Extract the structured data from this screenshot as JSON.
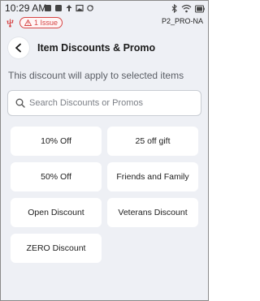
{
  "status_bar": {
    "time": "10:29 AM",
    "issue_badge": "1 Issue",
    "device_name": "P2_PRO-NA",
    "icons": [
      "notification-icon",
      "notification-icon",
      "upload-icon",
      "image-icon",
      "sync-icon",
      "bluetooth-icon",
      "wifi-icon",
      "battery-icon",
      "usb-icon",
      "warning-icon"
    ]
  },
  "header": {
    "title": "Item Discounts & Promo"
  },
  "subtitle": "This discount will apply to selected items",
  "search": {
    "placeholder": "Search Discounts or Promos",
    "value": ""
  },
  "discounts": [
    {
      "label": "10% Off"
    },
    {
      "label": "25 off gift"
    },
    {
      "label": "50% Off"
    },
    {
      "label": "Friends and Family"
    },
    {
      "label": "Open Discount"
    },
    {
      "label": "Veterans Discount"
    },
    {
      "label": "ZERO Discount"
    }
  ],
  "colors": {
    "background": "#eef0f5",
    "tile": "#ffffff",
    "alert": "#d64545",
    "text": "#1d1d1d",
    "muted": "#5b5f66"
  }
}
